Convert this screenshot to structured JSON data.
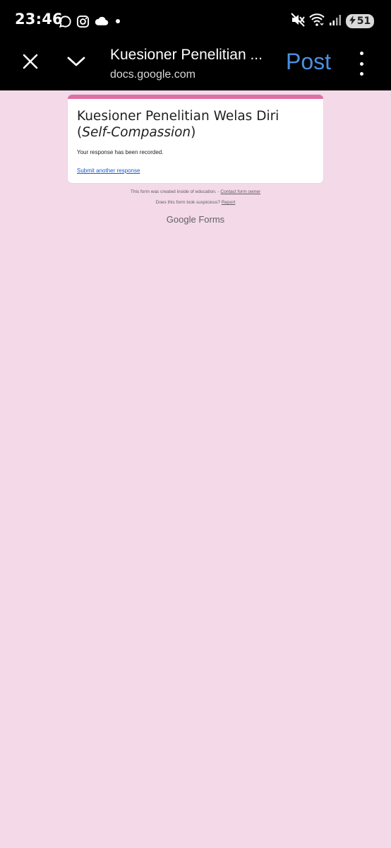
{
  "status_bar": {
    "time": "23:46",
    "battery_level": "51"
  },
  "browser": {
    "title": "Kuesioner Penelitian ...",
    "url": "docs.google.com",
    "post_label": "Post"
  },
  "form": {
    "title_plain": "Kuesioner Penelitian Welas Diri (",
    "title_italic": "Self-Compassion",
    "title_close": ")",
    "message": "Your response has been recorded.",
    "submit_another": "Submit another response",
    "accent_color": "#de6fa3"
  },
  "footer": {
    "created_text": "This form was created inside of education. -",
    "contact_link": "Contact form owner",
    "suspicious_text": "Does this form look suspicious?",
    "report_link": "Report",
    "brand_google": "Google",
    "brand_forms": "Forms"
  },
  "colors": {
    "page_background": "#f4d9e8",
    "post_button": "#4a90e2",
    "link": "#1a5cce"
  }
}
